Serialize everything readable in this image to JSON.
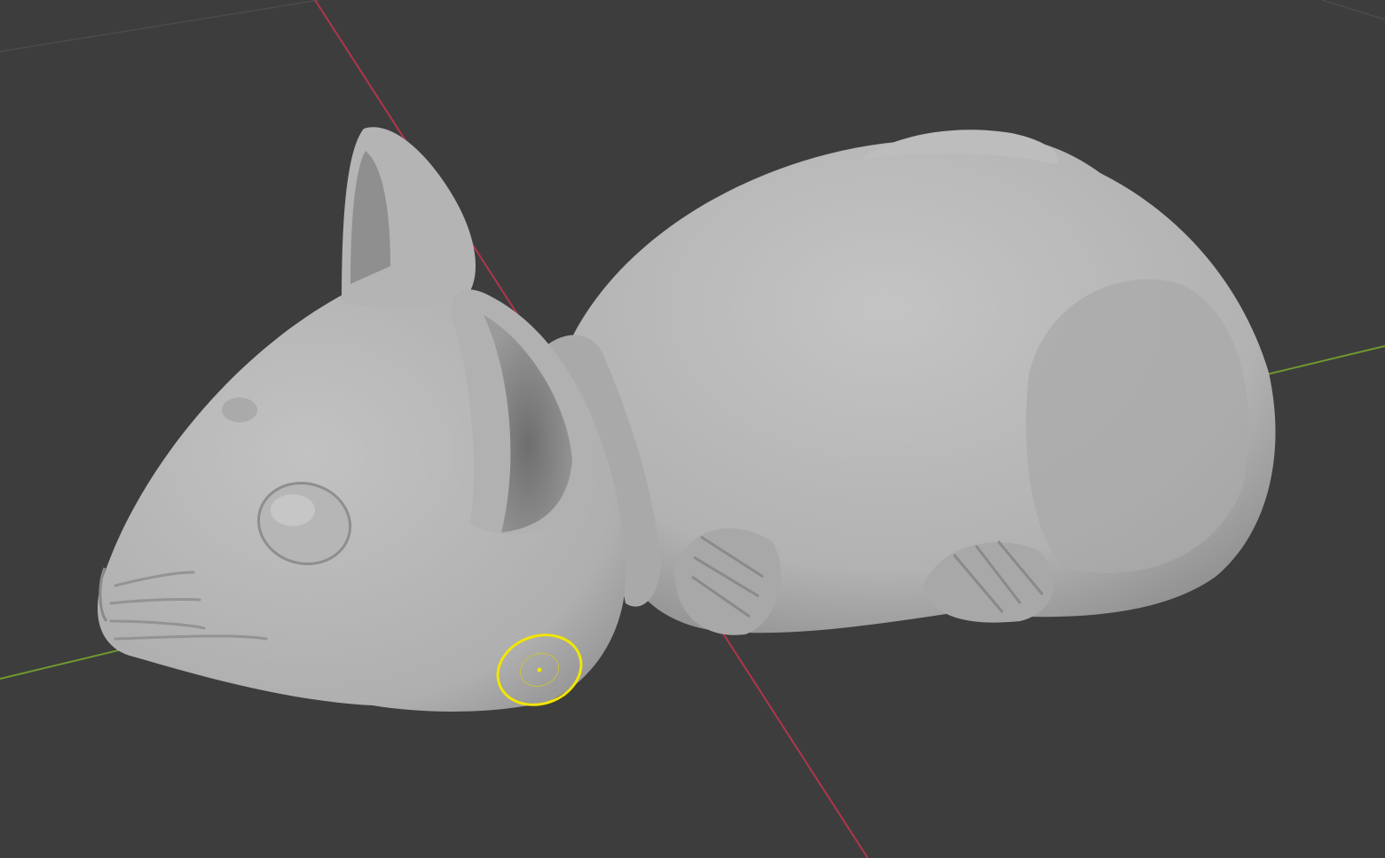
{
  "viewport": {
    "mode": "sculpt",
    "object": "mouse sculpt",
    "colors": {
      "background": "#3d3d3d",
      "grid_line": "#4a4a4a",
      "x_axis": "#b0364a",
      "y_axis": "#6f9a2e",
      "mesh": "#b9b9b9",
      "mesh_shadow": "#8a8a8a",
      "brush_cursor": "#f2e600"
    },
    "icons": [
      "brush-cursor-icon"
    ]
  }
}
